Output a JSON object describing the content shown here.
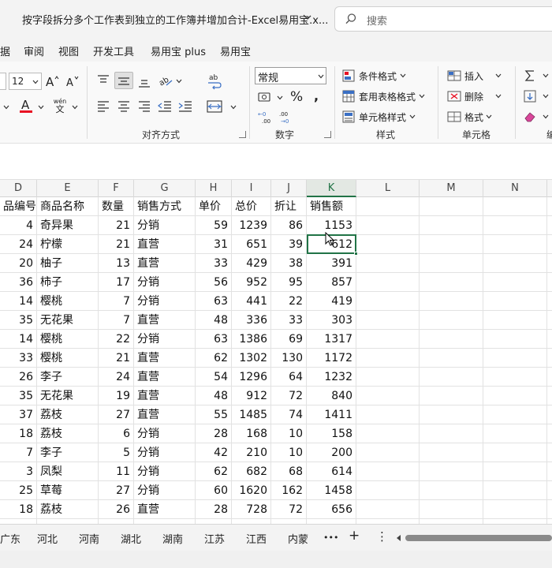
{
  "window": {
    "title": "按字段拆分多个工作表到独立的工作簿并增加合计-Excel易用宝.x...",
    "search_placeholder": "搜索"
  },
  "menu_tabs": [
    "据",
    "审阅",
    "视图",
    "开发工具",
    "易用宝 plus",
    "易用宝"
  ],
  "ribbon": {
    "font_size": "12",
    "phonetic_label": "wén\n文",
    "alignment_label": "对齐方式",
    "number_format": "常规",
    "number_label": "数字",
    "cond_format": "条件格式",
    "table_format": "套用表格格式",
    "cell_style": "单元格样式",
    "styles_label": "样式",
    "insert": "插入",
    "delete": "删除",
    "format": "格式",
    "cells_label": "单元格",
    "edit_label_partial": "编"
  },
  "columns": [
    "D",
    "E",
    "F",
    "G",
    "H",
    "I",
    "J",
    "K",
    "L",
    "M",
    "N"
  ],
  "selected_column": "K",
  "headers": [
    "品编号",
    "商品名称",
    "数量",
    "销售方式",
    "单价",
    "总价",
    "折让",
    "销售额"
  ],
  "rows": [
    [
      "4",
      "奇异果",
      "21",
      "分销",
      "59",
      "1239",
      "86",
      "1153"
    ],
    [
      "24",
      "柠檬",
      "21",
      "直营",
      "31",
      "651",
      "39",
      "612"
    ],
    [
      "20",
      "柚子",
      "13",
      "直营",
      "33",
      "429",
      "38",
      "391"
    ],
    [
      "36",
      "柿子",
      "17",
      "分销",
      "56",
      "952",
      "95",
      "857"
    ],
    [
      "14",
      "樱桃",
      "7",
      "分销",
      "63",
      "441",
      "22",
      "419"
    ],
    [
      "35",
      "无花果",
      "7",
      "直营",
      "48",
      "336",
      "33",
      "303"
    ],
    [
      "14",
      "樱桃",
      "22",
      "分销",
      "63",
      "1386",
      "69",
      "1317"
    ],
    [
      "33",
      "樱桃",
      "21",
      "直营",
      "62",
      "1302",
      "130",
      "1172"
    ],
    [
      "26",
      "李子",
      "24",
      "直营",
      "54",
      "1296",
      "64",
      "1232"
    ],
    [
      "35",
      "无花果",
      "19",
      "直营",
      "48",
      "912",
      "72",
      "840"
    ],
    [
      "37",
      "荔枝",
      "27",
      "直营",
      "55",
      "1485",
      "74",
      "1411"
    ],
    [
      "18",
      "荔枝",
      "6",
      "分销",
      "28",
      "168",
      "10",
      "158"
    ],
    [
      "7",
      "李子",
      "5",
      "分销",
      "42",
      "210",
      "10",
      "200"
    ],
    [
      "3",
      "凤梨",
      "11",
      "分销",
      "62",
      "682",
      "68",
      "614"
    ],
    [
      "25",
      "草莓",
      "27",
      "分销",
      "60",
      "1620",
      "162",
      "1458"
    ],
    [
      "18",
      "荔枝",
      "26",
      "直营",
      "28",
      "728",
      "72",
      "656"
    ]
  ],
  "sheet_tabs": [
    "广东",
    "河北",
    "河南",
    "湖北",
    "湖南",
    "江苏",
    "江西",
    "内蒙"
  ],
  "sheet_more": "•••",
  "sheet_add": "+",
  "sheet_menu": "⋮",
  "colors": {
    "accent": "#217346",
    "chrome": "#f3f3f3",
    "gridline": "#e2e2e2",
    "font_red": "#e81123"
  }
}
